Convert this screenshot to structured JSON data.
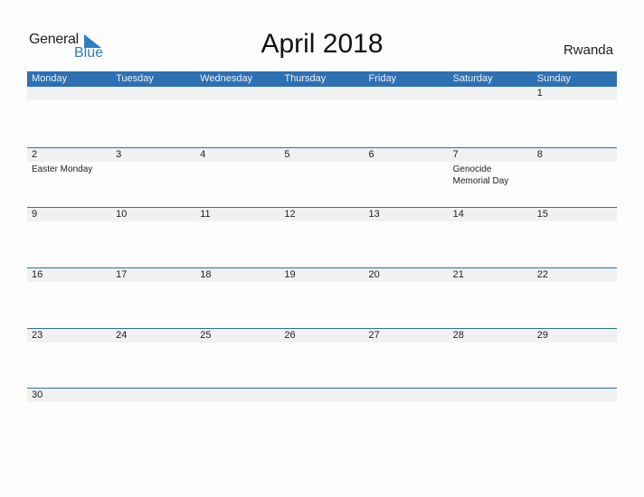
{
  "logo": {
    "line1": "General",
    "line2": "Blue"
  },
  "title": "April 2018",
  "country": "Rwanda",
  "colors": {
    "header_bg": "#2e70b4",
    "brand_blue": "#2f7ec1",
    "row_band": "#f1f1f1"
  },
  "weekdays": [
    "Monday",
    "Tuesday",
    "Wednesday",
    "Thursday",
    "Friday",
    "Saturday",
    "Sunday"
  ],
  "weeks": [
    [
      {
        "day": ""
      },
      {
        "day": ""
      },
      {
        "day": ""
      },
      {
        "day": ""
      },
      {
        "day": ""
      },
      {
        "day": ""
      },
      {
        "day": "1"
      }
    ],
    [
      {
        "day": "2",
        "event": "Easter Monday"
      },
      {
        "day": "3"
      },
      {
        "day": "4"
      },
      {
        "day": "5"
      },
      {
        "day": "6"
      },
      {
        "day": "7",
        "event": "Genocide Memorial Day"
      },
      {
        "day": "8"
      }
    ],
    [
      {
        "day": "9"
      },
      {
        "day": "10"
      },
      {
        "day": "11"
      },
      {
        "day": "12"
      },
      {
        "day": "13"
      },
      {
        "day": "14"
      },
      {
        "day": "15"
      }
    ],
    [
      {
        "day": "16"
      },
      {
        "day": "17"
      },
      {
        "day": "18"
      },
      {
        "day": "19"
      },
      {
        "day": "20"
      },
      {
        "day": "21"
      },
      {
        "day": "22"
      }
    ],
    [
      {
        "day": "23"
      },
      {
        "day": "24"
      },
      {
        "day": "25"
      },
      {
        "day": "26"
      },
      {
        "day": "27"
      },
      {
        "day": "28"
      },
      {
        "day": "29"
      }
    ],
    [
      {
        "day": "30"
      },
      {
        "day": ""
      },
      {
        "day": ""
      },
      {
        "day": ""
      },
      {
        "day": ""
      },
      {
        "day": ""
      },
      {
        "day": ""
      }
    ]
  ]
}
